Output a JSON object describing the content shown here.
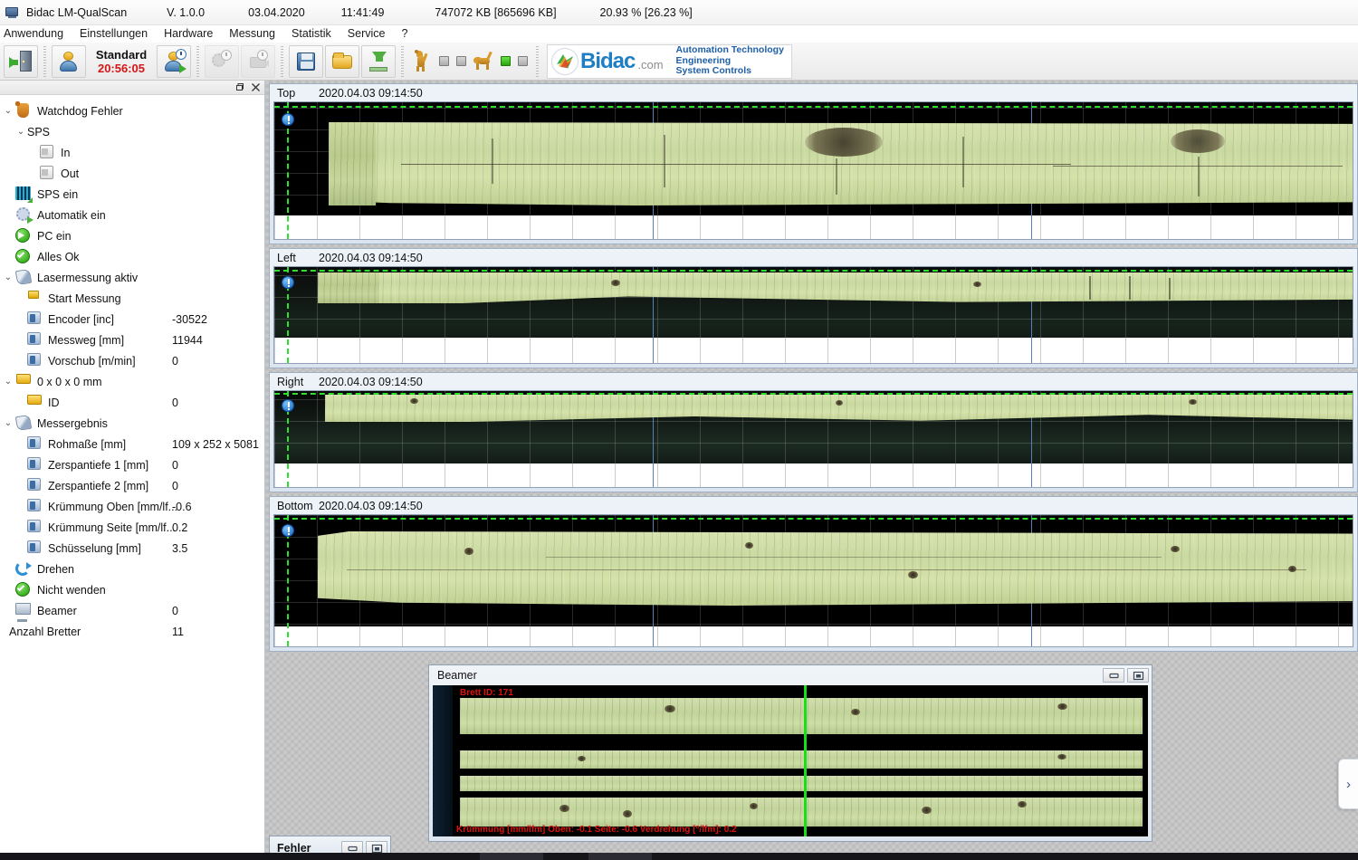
{
  "window": {
    "app_icon": "app-monitor-icon",
    "title": "Bidac LM-QualScan",
    "version": "V. 1.0.0",
    "date": "03.04.2020",
    "time": "11:41:49",
    "memory": "747072 KB [865696 KB]",
    "percent": "20.93 % [26.23 %]"
  },
  "menu": {
    "items": [
      {
        "label": "Anwendung"
      },
      {
        "label": "Einstellungen"
      },
      {
        "label": "Hardware"
      },
      {
        "label": "Messung"
      },
      {
        "label": "Statistik"
      },
      {
        "label": "Service"
      },
      {
        "label": "?"
      }
    ]
  },
  "toolbar": {
    "exit_button": "exit-door-icon",
    "user_button": "user-icon",
    "mode_label": "Standard",
    "mode_timer": "20:56:05",
    "user_start_button": "user-start-icon",
    "stats_button_disabled": "statistics-clock-icon",
    "camera_button_disabled": "camera-clock-icon",
    "save_button": "floppy-save-icon",
    "open_button": "folder-open-icon",
    "export_button": "export-download-icon",
    "dog_watchdog_1": "dog-standing-icon",
    "dog_watchdog_2": "dog-walking-icon",
    "leds": [
      {
        "name": "led-1",
        "state": "off"
      },
      {
        "name": "led-2",
        "state": "off"
      },
      {
        "name": "led-3",
        "state": "on"
      },
      {
        "name": "led-4",
        "state": "off"
      }
    ],
    "logo": {
      "brand": "Bidac",
      "domain": ".com",
      "tagline_1": "Automation Technology",
      "tagline_2": "Engineering",
      "tagline_3": "System Controls",
      "brand_color": "#1e7fc4",
      "tagline_color": "#1e5fa8"
    }
  },
  "sidebar": {
    "float_button": "restore-window-icon",
    "close_button": "close-icon",
    "tree": [
      {
        "label": "Watchdog Fehler",
        "value": "",
        "icon": "watchdog-dog-icon",
        "indent": 0,
        "chevron": "v"
      },
      {
        "label": "SPS",
        "value": "",
        "icon": "none",
        "indent": 1,
        "chevron": "v"
      },
      {
        "label": "In",
        "value": "",
        "icon": "checkbox-icon",
        "indent": 3,
        "chevron": ""
      },
      {
        "label": "Out",
        "value": "",
        "icon": "checkbox-icon",
        "indent": 3,
        "chevron": ""
      },
      {
        "label": "SPS ein",
        "value": "",
        "icon": "barcode-icon",
        "indent": 1,
        "chevron": ""
      },
      {
        "label": "Automatik ein",
        "value": "",
        "icon": "gear-play-icon",
        "indent": 1,
        "chevron": ""
      },
      {
        "label": "PC ein",
        "value": "",
        "icon": "green-arrow-circle-icon",
        "indent": 1,
        "chevron": ""
      },
      {
        "label": "Alles Ok",
        "value": "",
        "icon": "green-check-circle-icon",
        "indent": 1,
        "chevron": ""
      },
      {
        "label": "Lasermessung aktiv",
        "value": "",
        "icon": "laser-icon",
        "indent": 0,
        "chevron": "v"
      },
      {
        "label": "Start Messung",
        "value": "",
        "icon": "yellow-square-icon",
        "indent": 2,
        "chevron": ""
      },
      {
        "label": "Encoder [inc]",
        "value": "-30522",
        "icon": "tag-value-icon",
        "indent": 2,
        "chevron": ""
      },
      {
        "label": "Messweg [mm]",
        "value": "11944",
        "icon": "tag-value-icon",
        "indent": 2,
        "chevron": ""
      },
      {
        "label": "Vorschub [m/min]",
        "value": "0",
        "icon": "tag-value-icon",
        "indent": 2,
        "chevron": ""
      },
      {
        "label": "0 x 0 x 0 mm",
        "value": "",
        "icon": "folder-icon",
        "indent": 0,
        "chevron": "v"
      },
      {
        "label": "ID",
        "value": "0",
        "icon": "folder-icon",
        "indent": 2,
        "chevron": ""
      },
      {
        "label": "Messergebnis",
        "value": "",
        "icon": "laser-icon",
        "indent": 0,
        "chevron": "v"
      },
      {
        "label": "Rohmaße [mm]",
        "value": "109 x 252 x 5081",
        "icon": "tag-value-icon",
        "indent": 2,
        "chevron": ""
      },
      {
        "label": "Zerspantiefe 1 [mm]",
        "value": "0",
        "icon": "tag-value-icon",
        "indent": 2,
        "chevron": ""
      },
      {
        "label": "Zerspantiefe 2 [mm]",
        "value": "0",
        "icon": "tag-value-icon",
        "indent": 2,
        "chevron": ""
      },
      {
        "label": "Krümmung Oben [mm/lf...",
        "value": "-0.6",
        "icon": "tag-value-icon",
        "indent": 2,
        "chevron": ""
      },
      {
        "label": "Krümmung Seite [mm/lf...",
        "value": "0.2",
        "icon": "tag-value-icon",
        "indent": 2,
        "chevron": ""
      },
      {
        "label": "Schüsselung [mm]",
        "value": "3.5",
        "icon": "tag-value-icon",
        "indent": 2,
        "chevron": ""
      },
      {
        "label": "Drehen",
        "value": "",
        "icon": "rotate-icon",
        "indent": 1,
        "chevron": ""
      },
      {
        "label": "Nicht wenden",
        "value": "",
        "icon": "green-check-circle-icon",
        "indent": 1,
        "chevron": ""
      },
      {
        "label": "Beamer",
        "value": "0",
        "icon": "beamer-icon",
        "indent": 1,
        "chevron": ""
      },
      {
        "label": "Anzahl Bretter",
        "value": "11",
        "icon": "none",
        "indent": 0,
        "chevron": ""
      }
    ]
  },
  "views": [
    {
      "name": "Top",
      "timestamp": "2020.04.03 09:14:50"
    },
    {
      "name": "Left",
      "timestamp": "2020.04.03 09:14:50"
    },
    {
      "name": "Right",
      "timestamp": "2020.04.03 09:14:50"
    },
    {
      "name": "Bottom",
      "timestamp": "2020.04.03 09:14:50"
    }
  ],
  "beamer": {
    "title": "Beamer",
    "minimize_button": "minimize-icon",
    "restore_button": "restore-icon",
    "board_id": "Brett ID: 171",
    "measurements": "Krümmung [mm/lfm] Oben: -0.1 Seite: -0.6  Verdrehung [°/lfm]: 0.2",
    "text_color": "#e01010"
  },
  "fehler": {
    "title": "Fehler",
    "minimize_button": "minimize-icon",
    "restore_button": "restore-icon"
  },
  "flyout": {
    "icon": "chevron-right-icon"
  }
}
